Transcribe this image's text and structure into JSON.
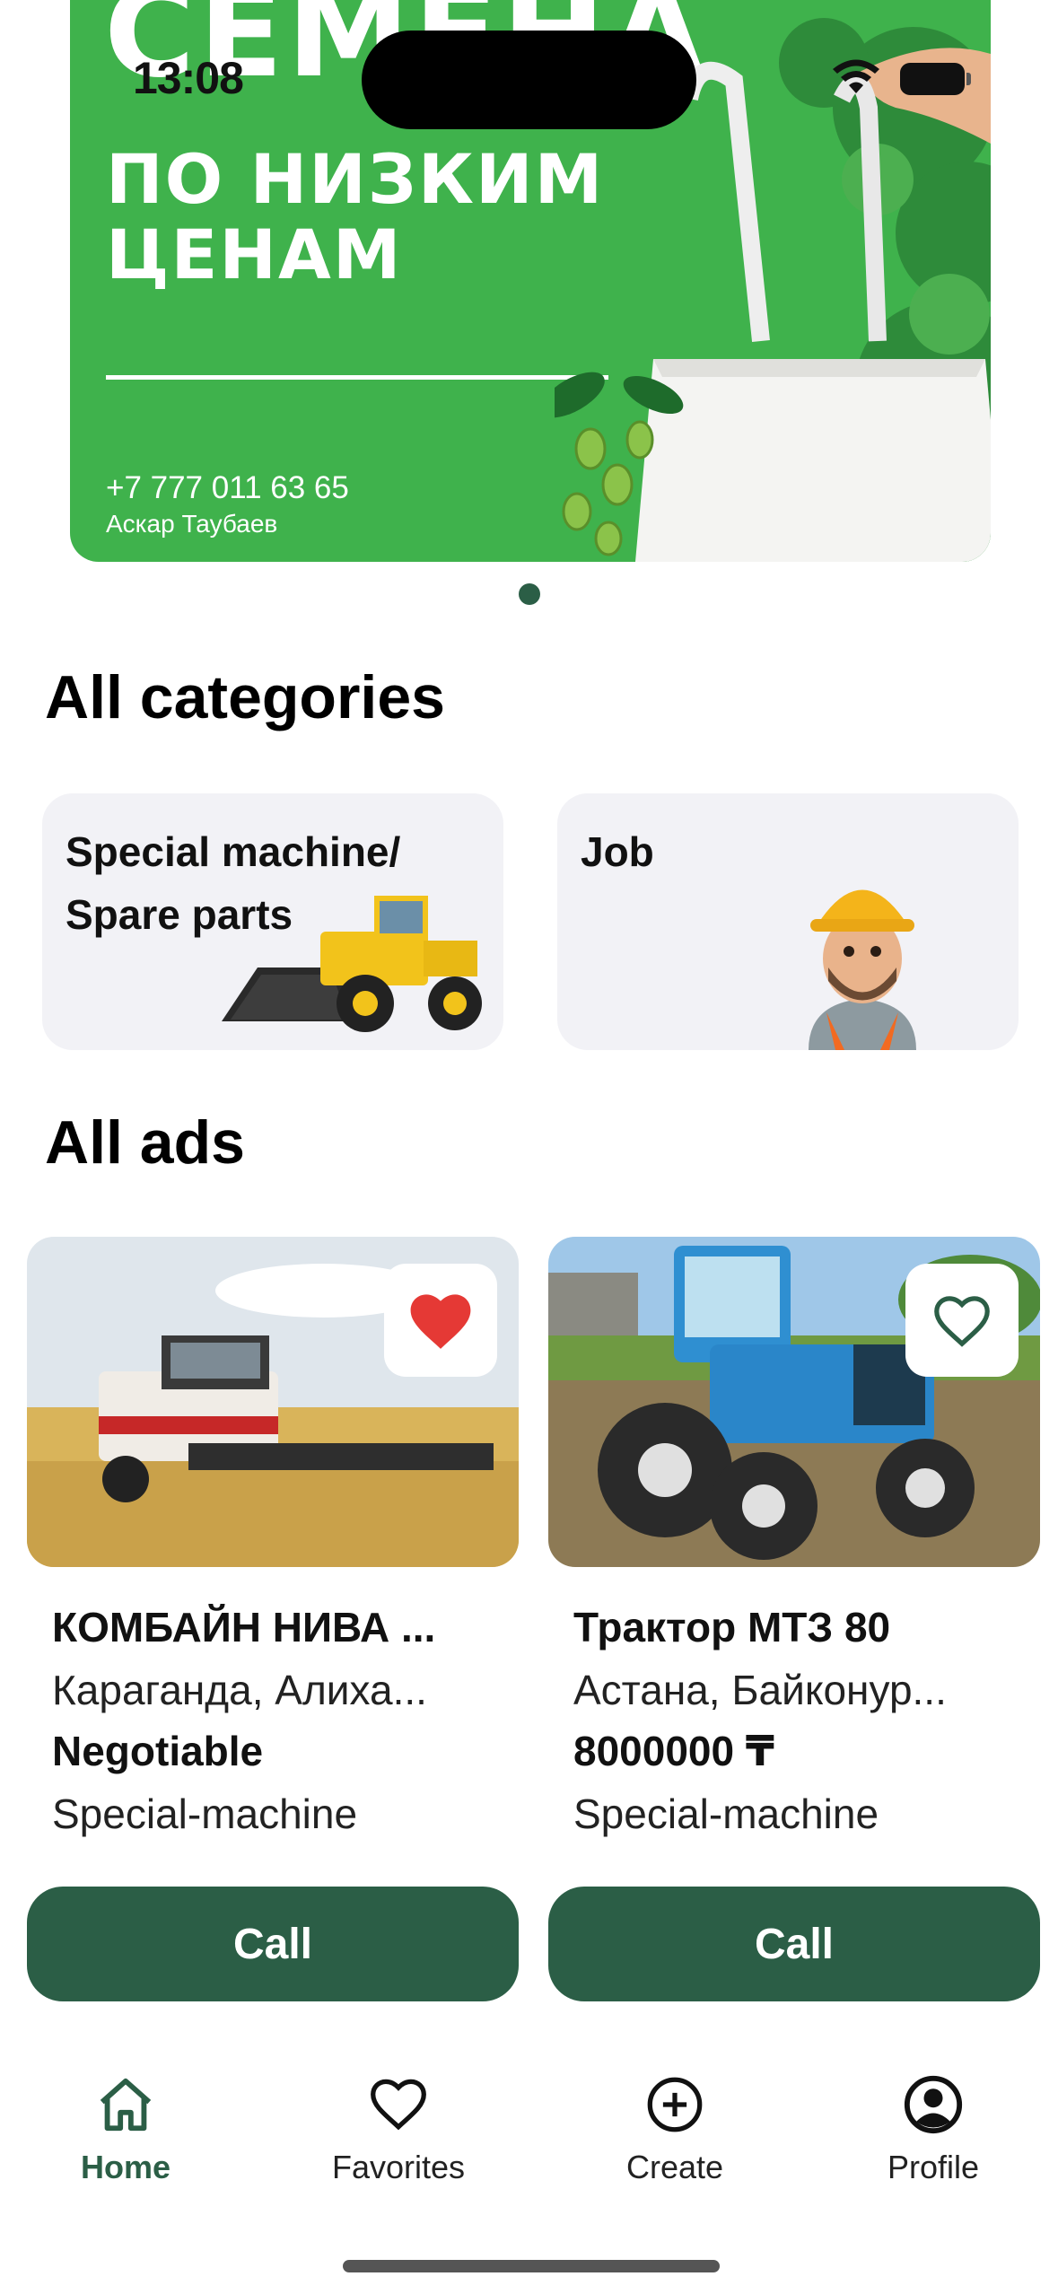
{
  "status": {
    "time": "13:08"
  },
  "banner": {
    "headline": "СЕМЕНА",
    "subtitle_line1": "ПО НИЗКИМ",
    "subtitle_line2": "ЦЕНАМ",
    "phone": "+7 777 011 63 65",
    "name": "Аскар Таубаев"
  },
  "carousel": {
    "current_index": 1,
    "count": 1
  },
  "categories": {
    "heading": "All categories",
    "items": [
      {
        "label_line1": "Special machine/",
        "label_line2": "Spare parts",
        "icon": "loader-machine-image"
      },
      {
        "label_line1": "Job",
        "label_line2": "",
        "icon": "worker-avatar-image"
      }
    ]
  },
  "ads": {
    "heading": "All ads",
    "items": [
      {
        "title": "КОМБАЙН НИВА ...",
        "location": "Караганда, Алиха...",
        "price": "Negotiable",
        "category": "Special-machine",
        "favorite": true,
        "call_label": "Call",
        "image": "combine-harvester-photo"
      },
      {
        "title": "Трактор МТЗ 80",
        "location": "Астана, Байконур...",
        "price": "8000000 ₸",
        "category": "Special-machine",
        "favorite": false,
        "call_label": "Call",
        "image": "blue-tractor-photo"
      }
    ]
  },
  "nav": {
    "items": [
      {
        "label": "Home",
        "icon": "home-icon",
        "active": true
      },
      {
        "label": "Favorites",
        "icon": "heart-icon",
        "active": false
      },
      {
        "label": "Create",
        "icon": "plus-circle-icon",
        "active": false
      },
      {
        "label": "Profile",
        "icon": "profile-icon",
        "active": false
      }
    ]
  },
  "colors": {
    "primary": "#2b5e46",
    "banner_green": "#3fb24c",
    "card_bg": "#f2f2f6",
    "heart_red": "#e53935"
  }
}
